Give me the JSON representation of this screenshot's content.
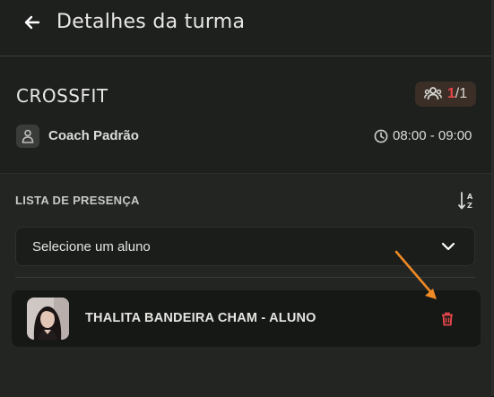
{
  "header": {
    "title": "Detalhes da turma",
    "back_icon": "arrow-left-icon"
  },
  "class": {
    "name": "CROSSFIT",
    "capacity_current": "1",
    "capacity_total": "/1",
    "capacity_icon": "users-icon",
    "coach_icon": "person-icon",
    "coach": "Coach Padrão",
    "time_icon": "clock-icon",
    "time": "08:00 - 09:00"
  },
  "attendance": {
    "label": "LISTA DE PRESENÇA",
    "sort_icon": "sort-alpha-icon",
    "select_placeholder": "Selecione um aluno",
    "select_icon": "chevron-down-icon",
    "students": [
      {
        "name": "THALITA BANDEIRA CHAM - ALUNO",
        "delete_icon": "trash-icon"
      }
    ]
  },
  "colors": {
    "background": "#1e201e",
    "section": "#232523",
    "accent_red": "#e8474b",
    "annotation_arrow": "#f08a24"
  }
}
